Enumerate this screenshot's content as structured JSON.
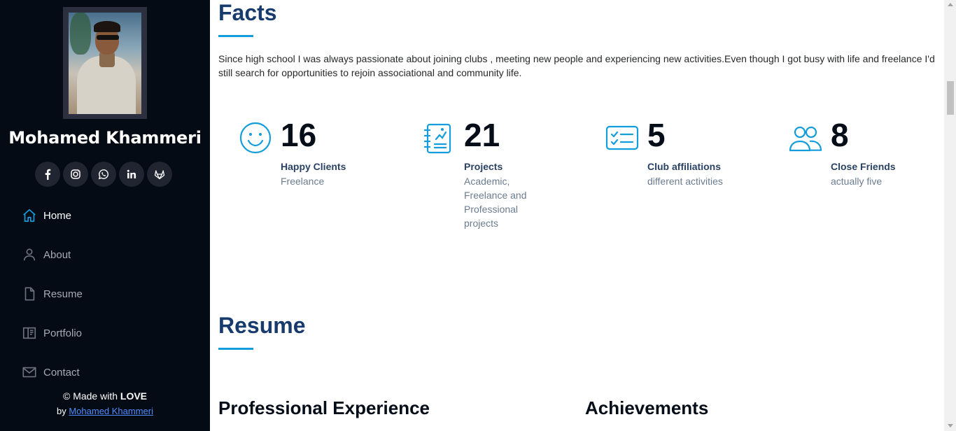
{
  "sidebar": {
    "name": "Mohamed Khammeri",
    "socials": [
      {
        "icon": "facebook-icon",
        "glyph": "f"
      },
      {
        "icon": "instagram-icon",
        "glyph": ""
      },
      {
        "icon": "whatsapp-icon",
        "glyph": ""
      },
      {
        "icon": "linkedin-icon",
        "glyph": "in"
      },
      {
        "icon": "gitlab-icon",
        "glyph": ""
      }
    ],
    "nav": [
      {
        "label": "Home",
        "icon": "house-icon",
        "active": true
      },
      {
        "label": "About",
        "icon": "person-icon",
        "active": false
      },
      {
        "label": "Resume",
        "icon": "file-icon",
        "active": false
      },
      {
        "label": "Portfolio",
        "icon": "book-icon",
        "active": false
      },
      {
        "label": "Contact",
        "icon": "envelope-icon",
        "active": false
      }
    ],
    "footer": {
      "made_prefix": "© Made with ",
      "made_bold": "LOVE",
      "by_prefix": "by ",
      "by_link": "Mohamed Khammeri"
    }
  },
  "main": {
    "facts": {
      "title": "Facts",
      "text": "Since high school I was always passionate about joining clubs , meeting new people and experiencing new activities.Even though I got busy with life and freelance I'd still search for opportunities to rejoin associational and community life."
    },
    "counts": [
      {
        "icon": "smiley-icon",
        "number": "16",
        "title": "Happy Clients",
        "desc": "Freelance"
      },
      {
        "icon": "journal-icon",
        "number": "21",
        "title": "Projects",
        "desc": "Academic, Freelance and Professional projects"
      },
      {
        "icon": "checklist-icon",
        "number": "5",
        "title": "Club affiliations",
        "desc": "different activities"
      },
      {
        "icon": "people-icon",
        "number": "8",
        "title": "Close Friends",
        "desc": "actually five"
      }
    ],
    "resume": {
      "title": "Resume",
      "professional_experience": "Professional Experience",
      "achievements": "Achievements"
    }
  },
  "colors": {
    "sidebar_bg": "#040b14",
    "accent": "#149ddd",
    "heading": "#173b6c",
    "link": "#4f8cff"
  }
}
